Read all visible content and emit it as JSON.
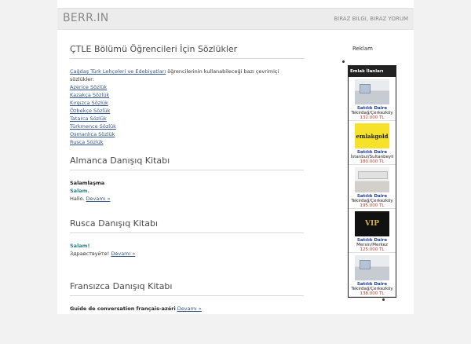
{
  "header": {
    "site_title": "BERR.IN",
    "tagline": "BIRAZ BILGI, BIRAZ YORUM"
  },
  "posts": [
    {
      "title": "ÇTLE Bölümü Öğrencileri İçin Sözlükler",
      "intro_link": "Çağdaş Türk Lehçeleri ve Edebiyatları",
      "intro_text": " öğrencilerinin kullanabileceği bazı çevrimiçi sözlükler:",
      "links": [
        "Azerice Sözlük",
        "Kazakça Sözlük",
        "Kırgızca Sözlük",
        "Özbekçe Sözlük",
        "Tatarca Sözlük",
        "Türkmence Sözlük",
        "Osmanlıca Sözlük",
        "Rusça Sözlük"
      ]
    },
    {
      "title": "Almanca Danışıq Kitabı",
      "line1": "Salamlaşma",
      "line2": "Salam.",
      "line3": "Hallo.",
      "more": "Devamı »"
    },
    {
      "title": "Rusca Danışıq Kitabı",
      "line1": "Salam!",
      "line2": "Здравствуйте!",
      "more": "Devamı »"
    },
    {
      "title": "Fransızca Danışıq Kitabı",
      "line1": "Guide de conversation français-azéri",
      "more": "Devamı »"
    }
  ],
  "sidebar": {
    "title": "Reklam",
    "widget_title": "Emlak İlanları",
    "ads": [
      {
        "name": "Satılık Daire",
        "location": "Tekirdağ/Çerkezköy",
        "price": "132.000 TL",
        "image": "room"
      },
      {
        "name": "Satılık Daire",
        "location": "İstanbul/Sultanbeyli",
        "price": "180.000 TL",
        "image": "logo",
        "logo_text": "emlakgold"
      },
      {
        "name": "Satılık Daire",
        "location": "Tekirdağ/Çerkezköy",
        "price": "195.000 TL",
        "image": "kitchen"
      },
      {
        "name": "Satılık Daire",
        "location": "Mersin/Merkez",
        "price": "125.000 TL",
        "image": "vip",
        "logo_text": "VIP"
      },
      {
        "name": "Satılık Daire",
        "location": "Tekirdağ/Çerkezköy",
        "price": "138.000 TL",
        "image": "room"
      }
    ]
  }
}
